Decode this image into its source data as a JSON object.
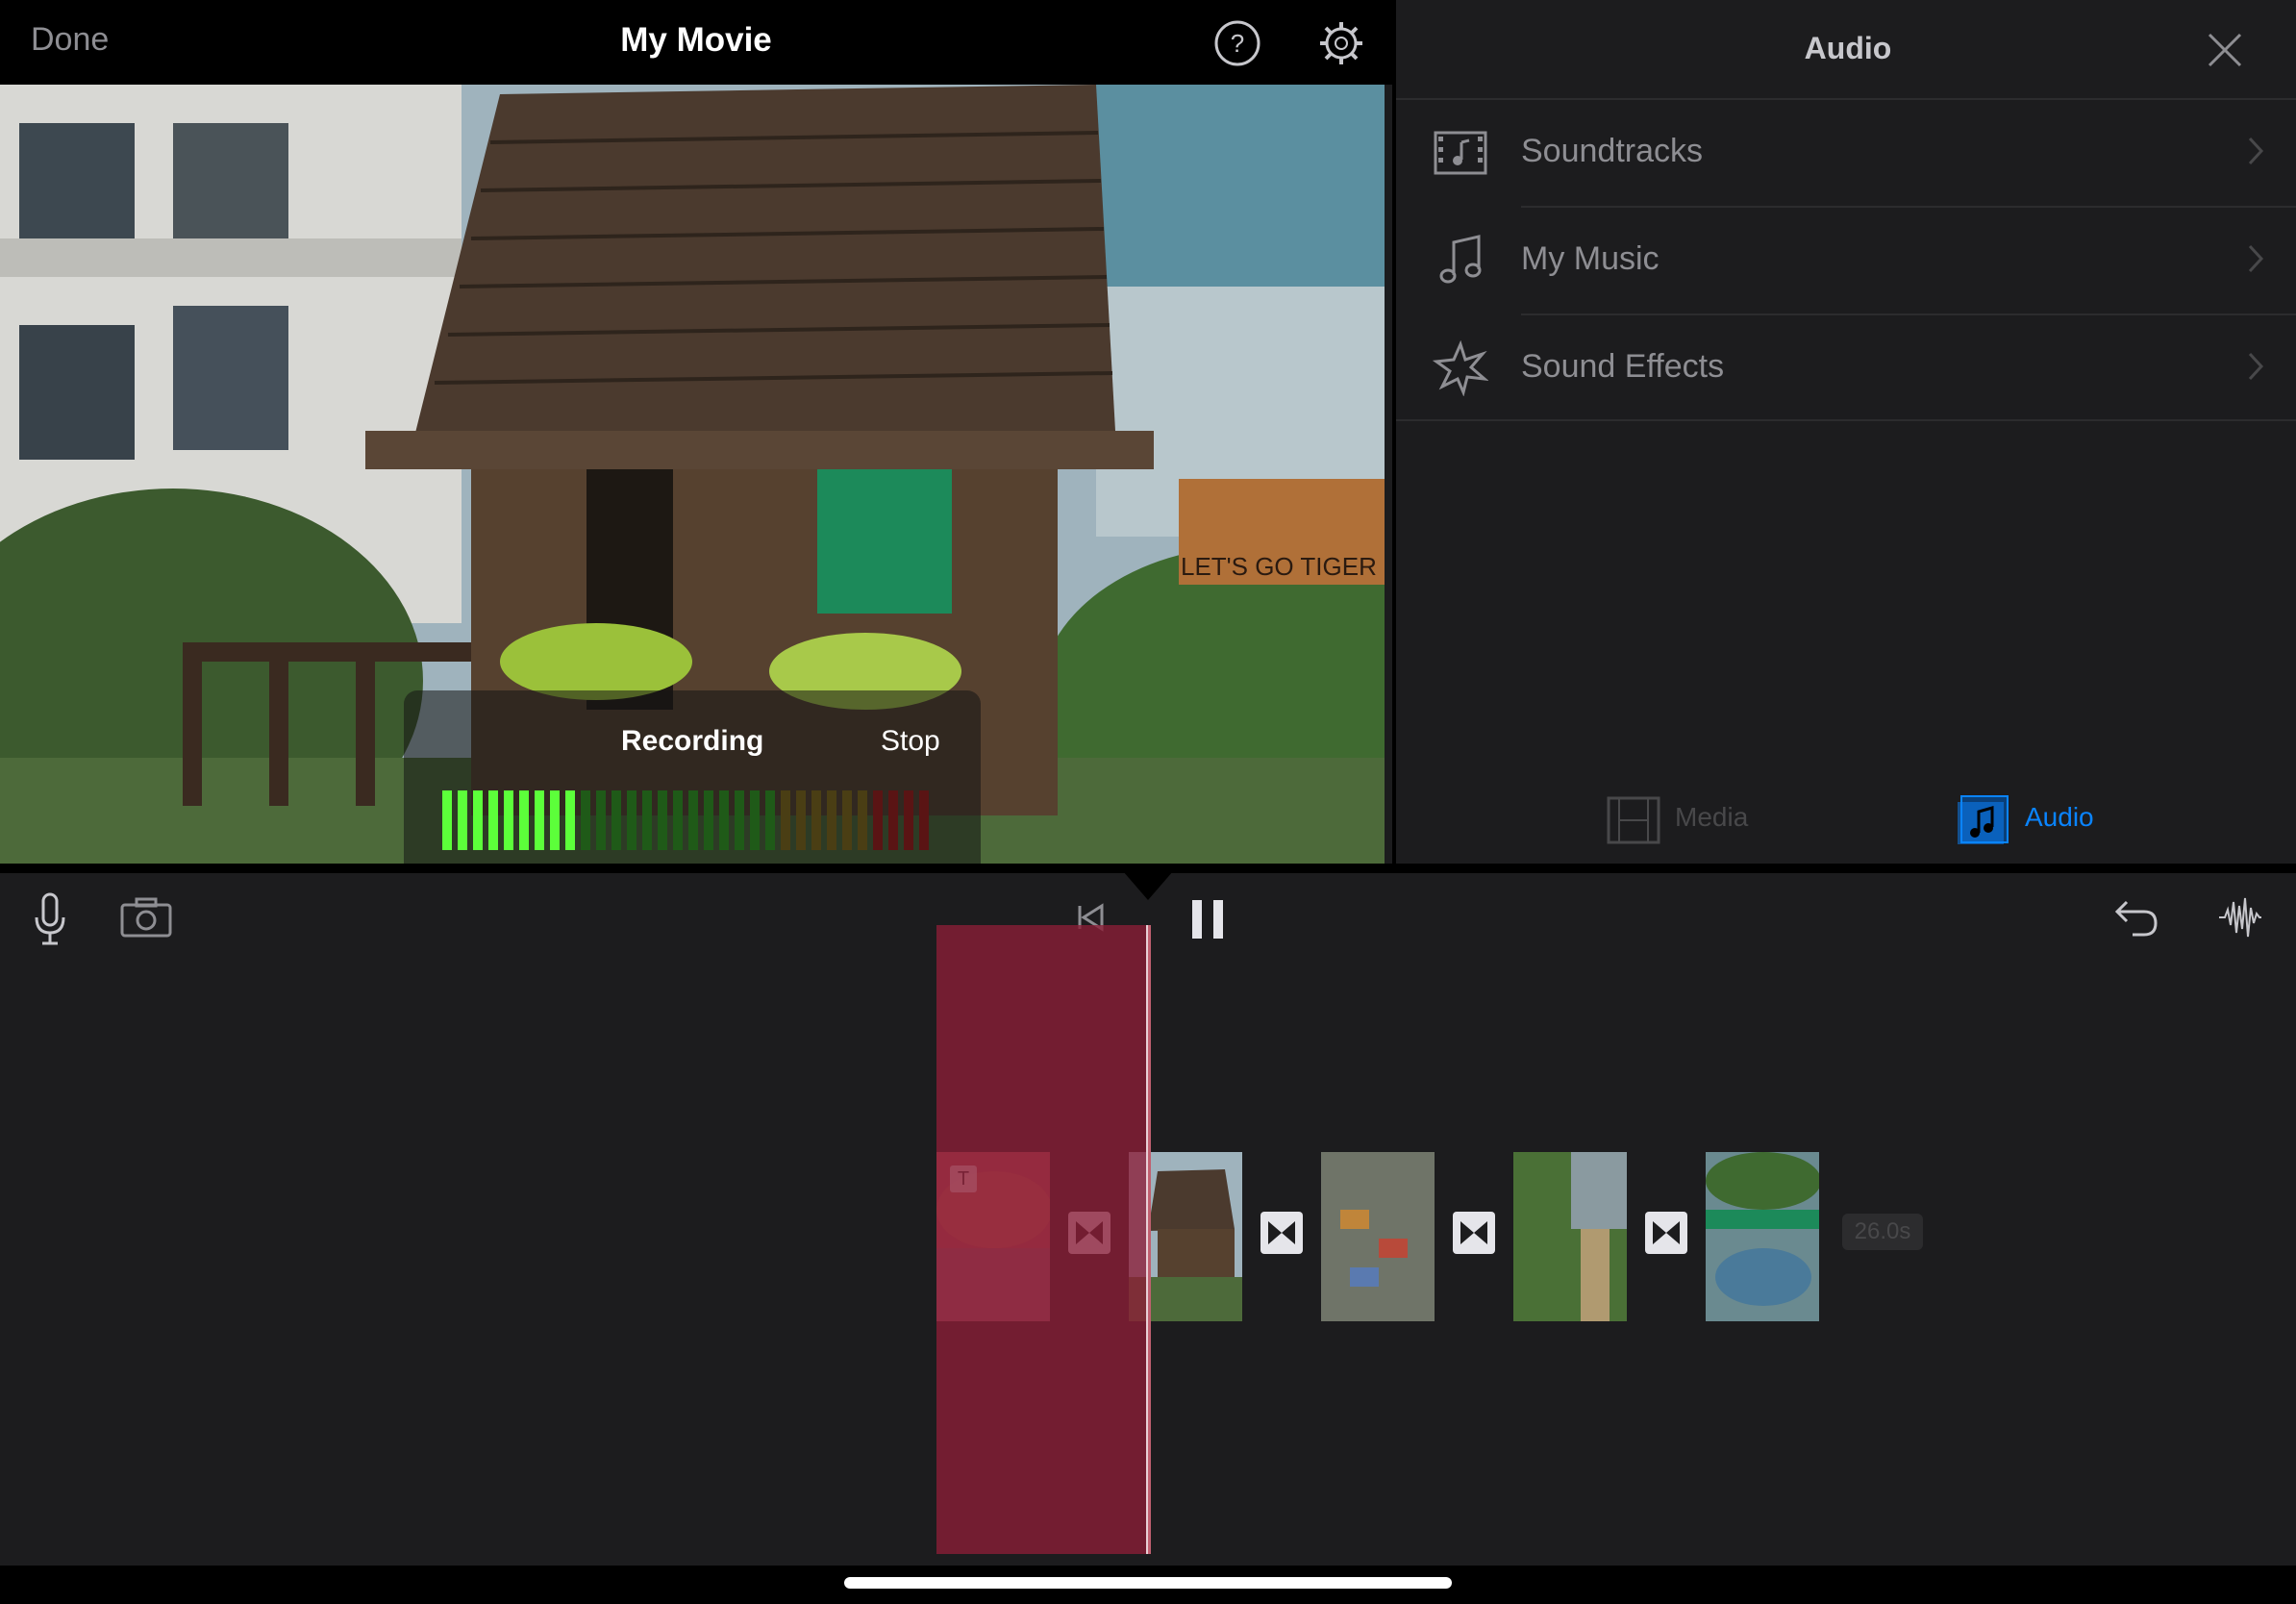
{
  "header": {
    "done_label": "Done",
    "title": "My Movie"
  },
  "viewer": {
    "banner_text": "LET'S GO TIGER"
  },
  "recording": {
    "status_label": "Recording",
    "stop_label": "Stop",
    "meter_level": 0.28
  },
  "audio_panel": {
    "title": "Audio",
    "items": [
      {
        "label": "Soundtracks",
        "icon": "film-music-icon"
      },
      {
        "label": "My Music",
        "icon": "music-note-icon"
      },
      {
        "label": "Sound Effects",
        "icon": "star-burst-icon"
      }
    ],
    "tabs": [
      {
        "label": "Media",
        "icon": "film-icon",
        "active": false
      },
      {
        "label": "Audio",
        "icon": "music-note-square-icon",
        "active": true
      }
    ]
  },
  "timeline": {
    "duration": "26.0s",
    "title_marker": "T"
  },
  "colors": {
    "accent": "#0a84ff",
    "record_region": "#8c1e37",
    "meter_active": "#5cff3a"
  }
}
